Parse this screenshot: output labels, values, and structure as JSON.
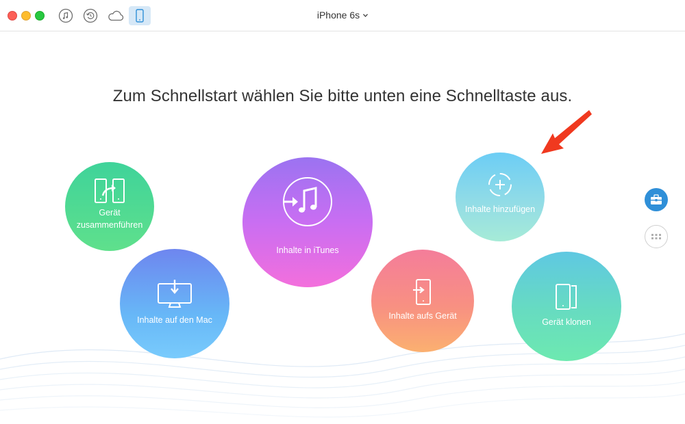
{
  "toolbar": {
    "device_name": "iPhone 6s",
    "icons": [
      "music-icon",
      "backup-icon",
      "cloud-icon",
      "iphone-icon"
    ]
  },
  "main": {
    "heading": "Zum Schnellstart wählen Sie bitte unten eine Schnelltaste aus.",
    "actions": [
      {
        "id": "merge",
        "label_line1": "Gerät",
        "label_line2": "zusammenführen",
        "icon": "merge-devices-icon"
      },
      {
        "id": "mac",
        "label": "Inhalte auf den Mac",
        "icon": "download-to-mac-icon"
      },
      {
        "id": "itunes",
        "label": "Inhalte in iTunes",
        "icon": "itunes-transfer-icon"
      },
      {
        "id": "device",
        "label": "Inhalte aufs Gerät",
        "icon": "import-to-device-icon"
      },
      {
        "id": "add",
        "label": "Inhalte hinzufügen",
        "icon": "add-content-icon"
      },
      {
        "id": "clone",
        "label": "Gerät klonen",
        "icon": "clone-device-icon"
      }
    ]
  },
  "sidebar": {
    "buttons": [
      "toolbox-icon",
      "grid-icon"
    ]
  },
  "colors": {
    "arrow": "#f0391f",
    "accent": "#2f8fd8"
  }
}
